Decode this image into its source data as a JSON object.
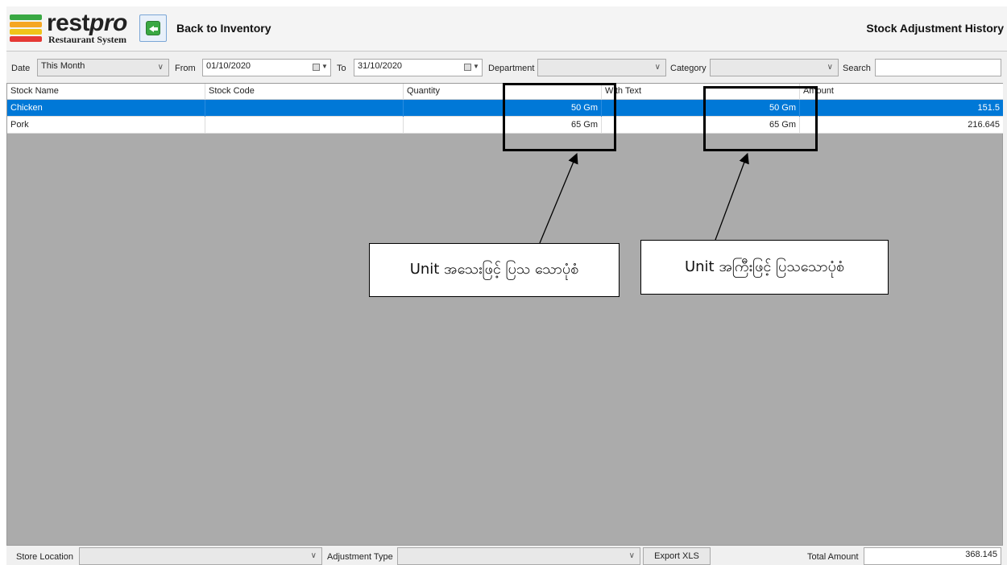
{
  "app": {
    "logo_main": "rest",
    "logo_italic": "pro",
    "logo_sub": "Restaurant System",
    "back_label": "Back to Inventory",
    "page_title": "Stock Adjustment History"
  },
  "filters": {
    "date_label": "Date",
    "date_value": "This Month",
    "from_label": "From",
    "from_value": "01/10/2020",
    "to_label": "To",
    "to_value": "31/10/2020",
    "department_label": "Department",
    "department_value": "",
    "category_label": "Category",
    "category_value": "",
    "search_label": "Search",
    "search_value": ""
  },
  "grid": {
    "columns": [
      "Stock Name",
      "Stock Code",
      "Quantity",
      "With Text",
      "Amount"
    ],
    "rows": [
      {
        "name": "Chicken",
        "code": "",
        "quantity": "50 Gm",
        "with_text": "50 Gm",
        "amount": "151.5",
        "selected": true
      },
      {
        "name": "Pork",
        "code": "",
        "quantity": "65 Gm",
        "with_text": "65 Gm",
        "amount": "216.645",
        "selected": false
      }
    ]
  },
  "annotations": {
    "callout_left": "Unit အသေးဖြင့် ပြသ သောပုံစံ",
    "callout_right": "Unit အကြီးဖြင့် ပြသသောပုံစံ"
  },
  "footer": {
    "store_location_label": "Store Location",
    "store_location_value": "",
    "adjustment_type_label": "Adjustment Type",
    "adjustment_type_value": "",
    "export_label": "Export XLS",
    "total_label": "Total Amount",
    "total_value": "368.145"
  },
  "colors": {
    "selection": "#0078d7",
    "grid_background": "#ababab"
  }
}
